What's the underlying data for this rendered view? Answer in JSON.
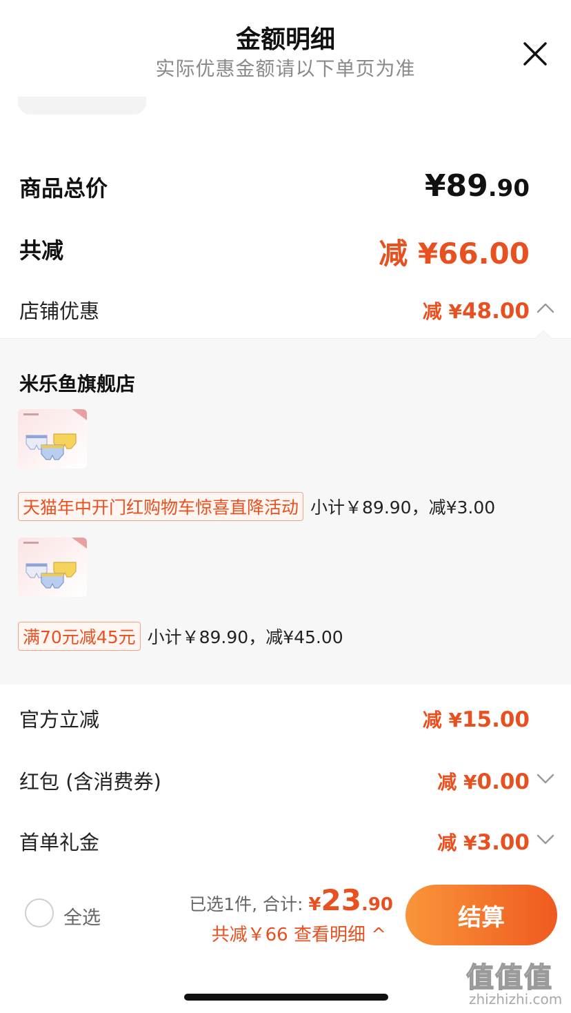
{
  "header": {
    "title": "金额明细",
    "subtitle": "实际优惠金额请以下单页为准",
    "close_icon": "close-icon"
  },
  "summary": {
    "total_label": "商品总价",
    "total_currency": "¥",
    "total_int": "89",
    "total_dec": ".90",
    "discount_label": "共减",
    "discount_value": "减 ¥66.00"
  },
  "store_discount": {
    "label": "店铺优惠",
    "value_prefix": "减 ¥",
    "value_amount": "48.00",
    "chevron": "chevron-up-icon"
  },
  "store": {
    "name": "米乐鱼旗舰店",
    "items": [
      {
        "promo_tag": "天猫年中开门红购物车惊喜直降活动",
        "promo_text": "小计￥89.90，减¥3.00"
      },
      {
        "promo_tag": "满70元减45元",
        "promo_text": "小计￥89.90，减¥45.00"
      }
    ]
  },
  "lines": [
    {
      "label": "官方立减",
      "value_prefix": "减 ¥",
      "value_amount": "15.00",
      "chevron": ""
    },
    {
      "label": "红包 (含消费券)",
      "value_prefix": "减 ¥",
      "value_amount": "0.00",
      "chevron": "chevron-down-icon"
    },
    {
      "label": "首单礼金",
      "value_prefix": "减 ¥",
      "value_amount": "3.00",
      "chevron": "chevron-down-icon"
    }
  ],
  "bottom_bar": {
    "select_all": "全选",
    "selected_text": "已选1件, 合计: ",
    "total_currency": "¥",
    "total_int": "23",
    "total_dec": ".90",
    "discount_detail": "共减￥66  查看明细 ^",
    "checkout_label": "结算"
  },
  "watermark": {
    "mark": "值值值",
    "url": "zhizhizhi.com"
  },
  "colors": {
    "accent": "#e8501f",
    "checkout_gradient_start": "#f9953a",
    "checkout_gradient_end": "#ef5a1f",
    "panel_bg": "#f7f7f7"
  }
}
